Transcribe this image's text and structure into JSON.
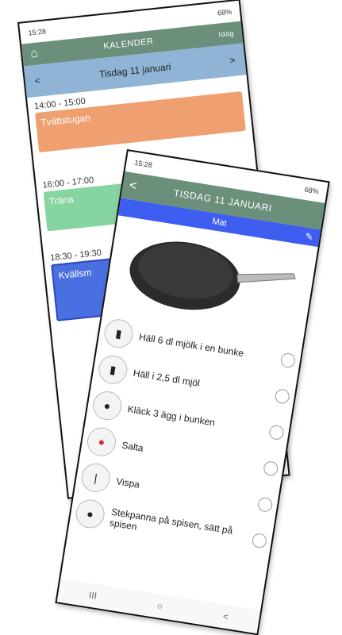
{
  "back": {
    "status": {
      "time": "15:28",
      "right": "68%"
    },
    "header": {
      "title": "KALENDER",
      "today": "Idag"
    },
    "date_bar": {
      "prev": "<",
      "label": "Tisdag 11 januari",
      "next": ">"
    },
    "events": [
      {
        "time": "14:00 - 15:00",
        "title": "Tvättstugan",
        "color": "#f0a070"
      },
      {
        "time": "16:00 - 17:00",
        "title": "Träna",
        "color": "#86d4a0"
      },
      {
        "time": "18:30 - 19:30",
        "title": "Kvällsm",
        "color": "#4a6fe0"
      }
    ]
  },
  "front": {
    "status": {
      "time": "15:28",
      "right": "68%"
    },
    "header": {
      "back": "<",
      "title": "TISDAG 11 JANUARI"
    },
    "subheader": {
      "title": "Mat"
    },
    "steps": [
      {
        "icon": "milk-icon",
        "label": "Häll 6 dl mjölk i en bunke"
      },
      {
        "icon": "flour-icon",
        "label": "Häll i 2,5 dl mjöl"
      },
      {
        "icon": "egg-icon",
        "label": "Kläck 3 ägg i bunken"
      },
      {
        "icon": "salt-icon",
        "label": "Salta"
      },
      {
        "icon": "whisk-icon",
        "label": "Vispa"
      },
      {
        "icon": "pan-icon",
        "label": "Stekpanna på spisen, sätt på spisen"
      }
    ],
    "nav": {
      "recent": "III",
      "home": "○",
      "back": "<"
    }
  }
}
